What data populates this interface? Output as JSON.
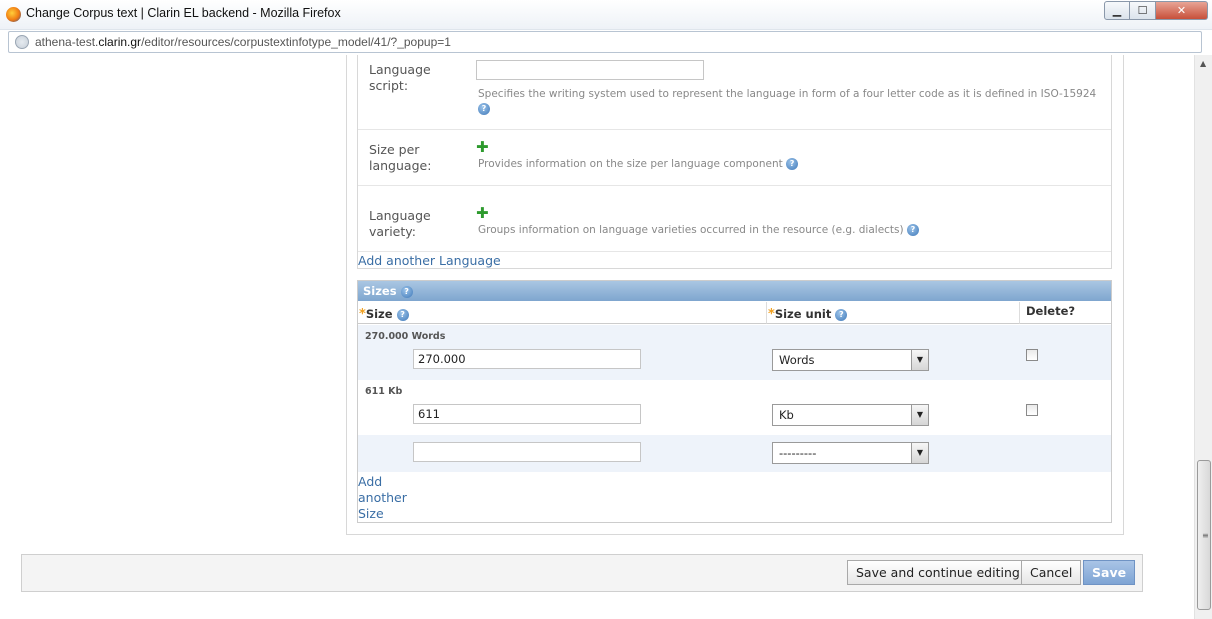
{
  "window": {
    "title": "Change Corpus text | Clarin EL backend - Mozilla Firefox",
    "controls": {
      "minimize": "▁",
      "maximize": "☐",
      "close": "✕"
    }
  },
  "url": {
    "prefix": "athena-test.",
    "domain": "clarin.gr",
    "path": "/editor/resources/corpustextinfotype_model/41/?_popup=1"
  },
  "language_fields": {
    "script": {
      "label": "Language script:",
      "value": "",
      "help": "Specifies the writing system used to represent the language in form of a four letter code as it is defined in ISO-15924"
    },
    "size_per_language": {
      "label": "Size per language:",
      "help": "Provides information on the size per language component"
    },
    "variety": {
      "label": "Language variety:",
      "help": "Groups information on language varieties occurred in the resource (e.g. dialects)"
    },
    "add_link": "Add another Language"
  },
  "sizes": {
    "title": "Sizes",
    "columns": {
      "size": "Size",
      "unit": "Size unit",
      "delete": "Delete?"
    },
    "rows": [
      {
        "caption": "270.000 Words",
        "size": "270.000",
        "unit": "Words",
        "checked": false
      },
      {
        "caption": "611 Kb",
        "size": "611",
        "unit": "Kb",
        "checked": false
      },
      {
        "caption": "",
        "size": "",
        "unit": "---------",
        "checked": false
      }
    ],
    "add_link": {
      "line1": "Add",
      "line2": "another",
      "line3": "Size"
    }
  },
  "buttons": {
    "save_continue": "Save and continue editing",
    "cancel": "Cancel",
    "save": "Save"
  },
  "icons": {
    "help": "?",
    "plus": "✚",
    "dropdown": "▼",
    "scroll_up": "▲",
    "scroll_grip": "≡"
  }
}
